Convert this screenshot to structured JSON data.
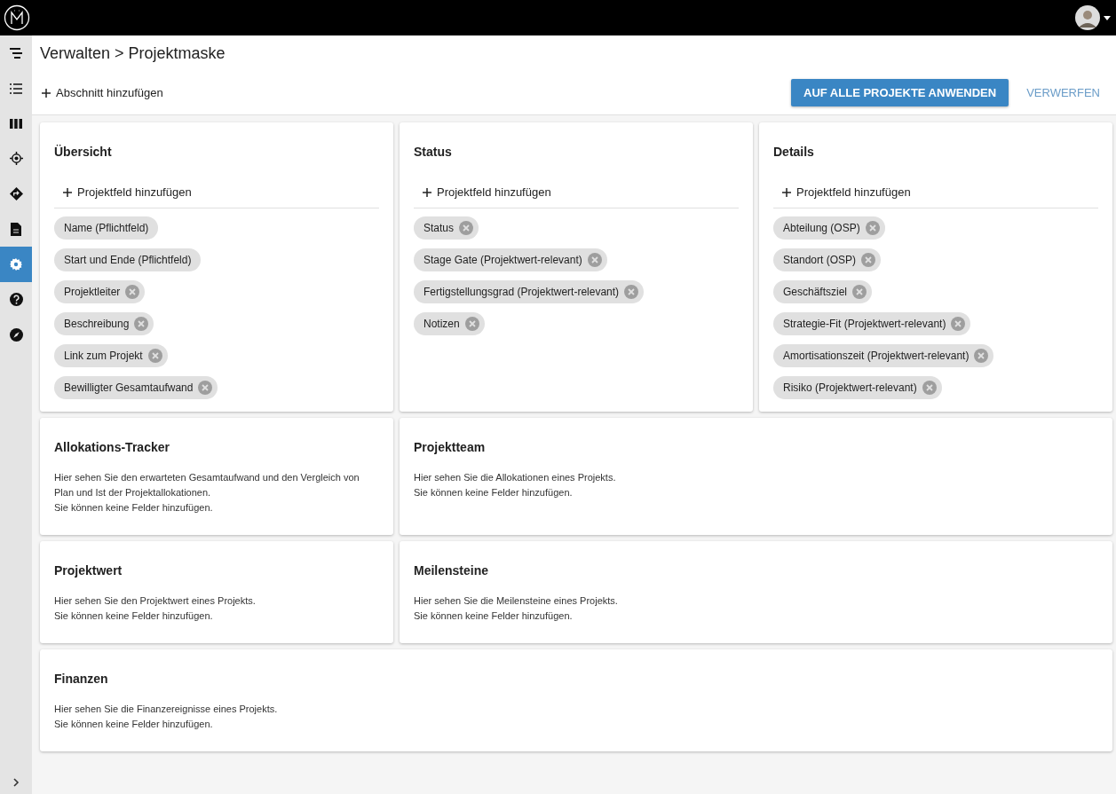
{
  "sidebar": {
    "items": [
      {
        "selected": false
      },
      {
        "selected": false
      },
      {
        "selected": false
      },
      {
        "selected": false
      },
      {
        "selected": false
      },
      {
        "selected": false
      },
      {
        "selected": true
      },
      {
        "selected": false
      },
      {
        "selected": false
      }
    ]
  },
  "breadcrumb": "Verwalten > Projektmaske",
  "toolbar": {
    "add_section": "Abschnitt hinzufügen",
    "apply": "AUF ALLE PROJEKTE ANWENDEN",
    "discard": "VERWERFEN"
  },
  "rows": [
    [
      {
        "kind": "fields",
        "title": "Übersicht",
        "add_field": "Projektfeld hinzufügen",
        "chips": [
          {
            "label": "Name (Pflichtfeld)",
            "removable": false
          },
          {
            "label": "Start und Ende (Pflichtfeld)",
            "removable": false
          },
          {
            "label": "Projektleiter",
            "removable": true
          },
          {
            "label": "Beschreibung",
            "removable": true
          },
          {
            "label": "Link zum Projekt",
            "removable": true
          },
          {
            "label": "Bewilligter Gesamtaufwand",
            "removable": true
          }
        ]
      },
      {
        "kind": "fields",
        "title": "Status",
        "add_field": "Projektfeld hinzufügen",
        "chips": [
          {
            "label": "Status",
            "removable": true
          },
          {
            "label": "Stage Gate (Projektwert-relevant)",
            "removable": true
          },
          {
            "label": "Fertigstellungsgrad (Projektwert-relevant)",
            "removable": true
          },
          {
            "label": "Notizen",
            "removable": true
          }
        ]
      },
      {
        "kind": "fields",
        "title": "Details",
        "add_field": "Projektfeld hinzufügen",
        "chips": [
          {
            "label": "Abteilung (OSP)",
            "removable": true
          },
          {
            "label": "Standort (OSP)",
            "removable": true
          },
          {
            "label": "Geschäftsziel",
            "removable": true
          },
          {
            "label": "Strategie-Fit (Projektwert-relevant)",
            "removable": true
          },
          {
            "label": "Amortisationszeit (Projektwert-relevant)",
            "removable": true
          },
          {
            "label": "Risiko (Projektwert-relevant)",
            "removable": true
          }
        ]
      }
    ],
    [
      {
        "kind": "info",
        "title": "Allokations-Tracker",
        "lines": [
          "Hier sehen Sie den erwarteten Gesamtaufwand und den Vergleich von Plan und Ist der Projektallokationen.",
          "Sie können keine Felder hinzufügen."
        ]
      },
      {
        "kind": "info",
        "title": "Projektteam",
        "lines": [
          "Hier sehen Sie die Allokationen eines Projekts.",
          "Sie können keine Felder hinzufügen."
        ]
      }
    ],
    [
      {
        "kind": "info",
        "title": "Projektwert",
        "lines": [
          "Hier sehen Sie den Projektwert eines Projekts.",
          "Sie können keine Felder hinzufügen."
        ]
      },
      {
        "kind": "info",
        "title": "Meilensteine",
        "lines": [
          "Hier sehen Sie die Meilensteine eines Projekts.",
          "Sie können keine Felder hinzufügen."
        ]
      }
    ],
    [
      {
        "kind": "info",
        "title": "Finanzen",
        "lines": [
          "Hier sehen Sie die Finanzereignisse eines Projekts.",
          "Sie können keine Felder hinzufügen."
        ]
      }
    ]
  ]
}
